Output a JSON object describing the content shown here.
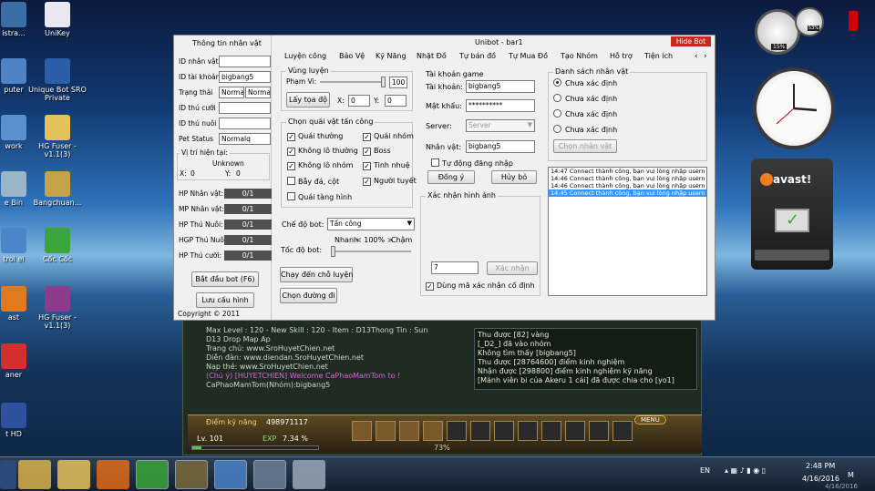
{
  "desktop_icons": [
    {
      "label": "istra...",
      "icon": "app-icon",
      "color": "#3b6ea5"
    },
    {
      "label": "UniKey",
      "icon": "unikey-icon",
      "color": "#e8e8f0"
    },
    {
      "label": "puter",
      "icon": "computer-icon",
      "color": "#4f84c4"
    },
    {
      "label": "Unique Bot SRO Private",
      "icon": "bot-icon",
      "color": "#2d5fa8"
    },
    {
      "label": "work",
      "icon": "network-icon",
      "color": "#5a8fd0"
    },
    {
      "label": "HG Fuser - v1.1(3)",
      "icon": "folder-icon",
      "color": "#e4c15a"
    },
    {
      "label": "e Bin",
      "icon": "recycle-bin-icon",
      "color": "#9bb4c8"
    },
    {
      "label": "Bangchuan...",
      "icon": "folder-icon",
      "color": "#c7a24a"
    },
    {
      "label": "trol el",
      "icon": "control-panel-icon",
      "color": "#4d86c8"
    },
    {
      "label": "Cốc Cốc",
      "icon": "coccoc-icon",
      "color": "#3aa53a"
    },
    {
      "label": "ast",
      "icon": "app-icon",
      "color": "#e07a1f"
    },
    {
      "label": "HG Fuser - v1.1(3)",
      "icon": "winrar-icon",
      "color": "#8e3b8e"
    },
    {
      "label": "aner",
      "icon": "app-icon",
      "color": "#d03030"
    },
    {
      "label": "t HD",
      "icon": "app-icon",
      "color": "#3050a0"
    }
  ],
  "game": {
    "chat_left": [
      "Max Level : 120 - New Skill : 120 - Item : D13Thong Tin : Sun",
      "D13 Drop Map Ap",
      "Trang chủ: www.SroHuyetChien.net",
      "Diễn đàn: www.diendan.SroHuyetChien.net",
      "Nạp thẻ: www.SroHuyetChien.net",
      "(Chú ý) [HUYETCHIEN] Welcome CaPhaoMamTom to !",
      "CaPhaoMamTom(Nhóm):bigbang5"
    ],
    "chat_right": [
      "Thu được [82] vàng",
      "[_D2_] đã vào nhóm",
      "Không tìm thấy [bigbang5]",
      "Thu được [28764600] điểm kinh nghiệm",
      "Nhận được [298800] điểm kinh nghiệm kỹ năng",
      "[Mảnh viên bi của Akeru 1 cái] đã được chia cho [yo1]"
    ],
    "skill_label": "Điểm kỹ năng",
    "skill_points": "498971117",
    "level": "Lv. 101",
    "exp_label": "EXP",
    "exp_value": "7.34 %",
    "exp_fraction": 0.0734,
    "pct": "73%",
    "menu": "MENU"
  },
  "window": {
    "title": "Unibot - bar1",
    "hide_bot": "Hide Bot",
    "left": {
      "title": "Thông tin nhân vật",
      "fields": [
        {
          "label": "ID nhân vật",
          "value": ""
        },
        {
          "label": "ID tài khoản",
          "value": "bigbang5"
        },
        {
          "label": "Trạng thái",
          "value": "Normal",
          "value2": "Normal"
        },
        {
          "label": "ID thú cưỡi",
          "value": ""
        },
        {
          "label": "ID thú nuôi",
          "value": ""
        },
        {
          "label": "Pet Status",
          "value": "Normalq"
        }
      ],
      "pos_title": "Vị trí hiện tại:",
      "pos_place": "Unknown",
      "x_label": "X:",
      "x_value": "0",
      "y_label": "Y:",
      "y_value": "0",
      "bars": [
        {
          "label": "HP Nhân vật:",
          "value": "0/1"
        },
        {
          "label": "MP Nhân vật:",
          "value": "0/1"
        },
        {
          "label": "HP Thú Nuôi:",
          "value": "0/1"
        },
        {
          "label": "HGP Thú Nuôi:",
          "value": "0/1"
        },
        {
          "label": "HP Thú cưỡi:",
          "value": "0/1"
        }
      ],
      "start_btn": "Bắt đầu bot (F6)",
      "save_btn": "Lưu cấu hình",
      "copyright": "Copyright © 2011"
    },
    "tabs": [
      "Luyện công",
      "Bảo Vệ",
      "Kỹ Năng",
      "Nhặt Đồ",
      "Tự bán đồ",
      "Tự Mua Đồ",
      "Tạo Nhóm",
      "Hỗ trợ",
      "Tiện ích"
    ],
    "train": {
      "title": "Vùng luyện",
      "range_label": "Phạm Vi:",
      "range_value": "100",
      "range_fraction": 1.0,
      "get_pos": "Lấy tọa độ",
      "x_label": "X:",
      "x_value": "0",
      "y_label": "Y:",
      "y_value": "0"
    },
    "monsters": {
      "title": "Chọn quái vật tấn công",
      "items": [
        {
          "label": "Quái thường",
          "checked": true
        },
        {
          "label": "Quái nhóm",
          "checked": true
        },
        {
          "label": "Không lô thường",
          "checked": true
        },
        {
          "label": "Boss",
          "checked": true
        },
        {
          "label": "Không lô nhóm",
          "checked": true
        },
        {
          "label": "Tinh nhuệ",
          "checked": true
        },
        {
          "label": "Bẫy đá, cột",
          "checked": false
        },
        {
          "label": "Người tuyết",
          "checked": true
        },
        {
          "label": "Quái tàng hình",
          "checked": false
        }
      ]
    },
    "mode_label": "Chế độ bot:",
    "mode_value": "Tấn công",
    "speed_label": "Tốc độ bot:",
    "speed_fast": "Nhanh",
    "speed_value": "< 100% >",
    "speed_slow": "Chậm",
    "speed_fraction": 0.0,
    "go_train": "Chạy đến chỗ luyện",
    "choose_path": "Chọn đường đi",
    "account": {
      "title": "Tài khoản game",
      "acc_label": "Tài khoản:",
      "acc_value": "bigbang5",
      "pass_label": "Mật khẩu:",
      "pass_value": "**********",
      "server_label": "Server:",
      "server_value": "Server",
      "char_label": "Nhân vật:",
      "char_value": "bigbang5",
      "auto_login": "Tự động đăng nhập",
      "agree": "Đồng ý",
      "cancel": "Hủy bỏ"
    },
    "captcha": {
      "title": "Xác nhận hình ảnh",
      "input": "7",
      "confirm": "Xác nhận",
      "use_fixed": "Dùng mã xác nhận cố định"
    },
    "chars": {
      "title": "Danh sách nhân vật",
      "items": [
        "Chưa xác định",
        "Chưa xác định",
        "Chưa xác định",
        "Chưa xác định"
      ],
      "choose": "Chọn nhân vật"
    },
    "log": [
      "14:47 Connect thành công, bạn vui lòng nhập usern",
      "14:46 Connect thành công, bạn vui lòng nhập usern",
      "14:46 Connect thành công, bạn vui lòng nhập usern",
      "14:45 Connect thành công, bạn vui lòng nhập usern"
    ]
  },
  "gadgets": {
    "meter1": "15%",
    "meter2": "53%",
    "avast": "avast!"
  },
  "taskbar": {
    "lang": "EN",
    "time": "2:48 PM",
    "date": "4/16/2016",
    "mini_letter": "M",
    "mini_date": "4/16/2016"
  }
}
